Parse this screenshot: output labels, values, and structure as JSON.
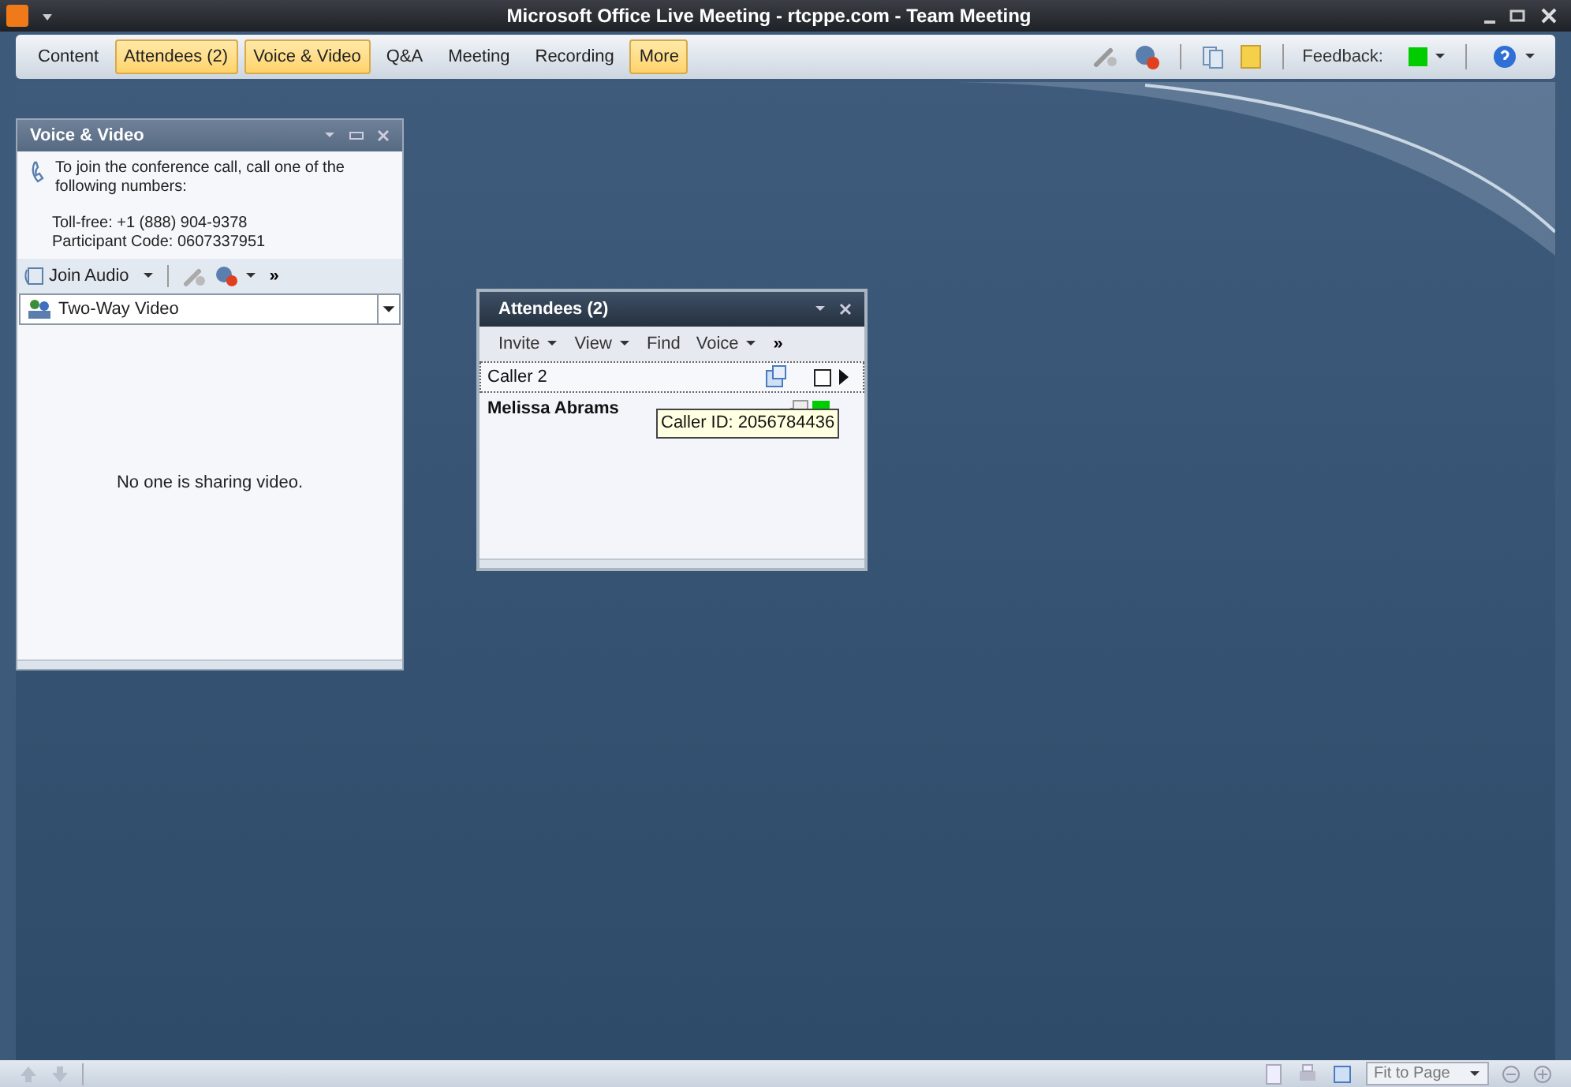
{
  "window": {
    "title": "Microsoft Office Live Meeting - rtcppe.com - Team Meeting"
  },
  "menu": [
    {
      "label": "Content",
      "selected": false
    },
    {
      "label": "Attendees (2)",
      "selected": true
    },
    {
      "label": "Voice & Video",
      "selected": true
    },
    {
      "label": "Q&A",
      "selected": false
    },
    {
      "label": "Meeting",
      "selected": false
    },
    {
      "label": "Recording",
      "selected": false
    },
    {
      "label": "More",
      "selected": true
    }
  ],
  "feedback": {
    "label": "Feedback:",
    "color": "#00cc00"
  },
  "voice_panel": {
    "title": "Voice & Video",
    "info": "To join the conference call, call one of the following numbers:",
    "toll_free": "Toll-free: +1 (888) 904-9378",
    "participant_code": "Participant Code: 0607337951",
    "join_audio": "Join Audio",
    "more": "»",
    "video_mode": "Two-Way Video",
    "empty_message": "No one is sharing video."
  },
  "attendees_panel": {
    "title": "Attendees (2)",
    "toolbar": [
      "Invite",
      "View",
      "Find",
      "Voice"
    ],
    "more": "»",
    "rows": [
      {
        "name": "Caller 2",
        "bold": false,
        "selected": true
      },
      {
        "name": "Melissa Abrams",
        "bold": true,
        "selected": false,
        "color": "#00cc00"
      }
    ],
    "tooltip": "Caller ID: 2056784436"
  },
  "status_bar": {
    "zoom": "Fit to Page"
  }
}
